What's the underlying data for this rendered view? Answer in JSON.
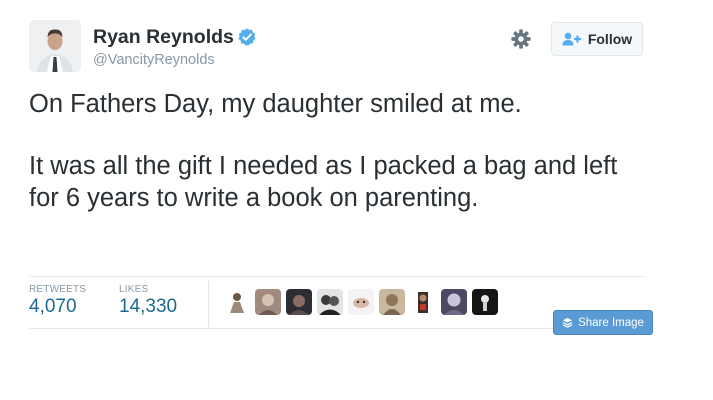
{
  "tweet": {
    "author": {
      "name": "Ryan Reynolds",
      "handle": "@VancityReynolds",
      "verified": true,
      "avatar": "profile-photo"
    },
    "follow_button": {
      "label": "Follow",
      "icon": "add-user-icon"
    },
    "settings_icon": "gear-icon",
    "text_paragraphs": [
      "On Fathers Day, my daughter smiled at me.",
      "It was all the gift I needed as I packed a bag and left for 6 years to write a book on parenting."
    ],
    "stats": {
      "retweets_label": "RETWEETS",
      "retweets_value": "4,070",
      "likes_label": "LIKES",
      "likes_value": "14,330"
    },
    "liker_avatar_count": 9,
    "share_button": {
      "label": "Share Image",
      "icon": "layers-icon"
    }
  },
  "colors": {
    "text": "#292f33",
    "muted": "#8899a6",
    "stat_value": "#1b6b8f",
    "verified_badge": "#55acee",
    "follow_icon": "#55acee",
    "share_button_bg": "#5b9bd5",
    "divider": "#e1e8ed"
  }
}
